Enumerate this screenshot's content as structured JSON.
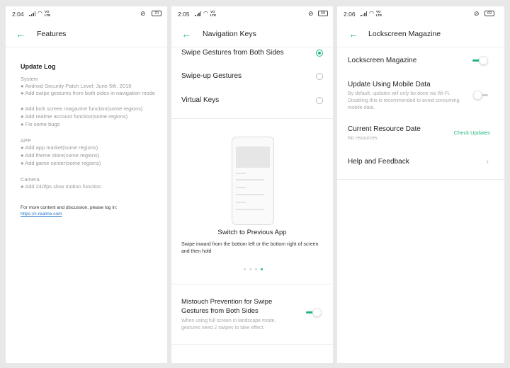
{
  "accent_color": "#1fb87a",
  "panels": [
    {
      "status": {
        "time": "2:04",
        "battery": "70"
      },
      "title": "Features",
      "update_log": {
        "heading": "Update Log",
        "system": {
          "label": "System",
          "items": [
            "● Android Security Patch Level: June 5th, 2019",
            "● Add swipe gestures from both sides in navigation mode",
            "● Add lock screen magazine function(some regions)",
            "● Add realme account function(some regions)",
            "● Fix some bugs"
          ]
        },
        "app": {
          "label": "APP",
          "items": [
            "● Add app market(some regions)",
            "● Add theme store(some regions)",
            "● Add game center(some regions)"
          ]
        },
        "camera": {
          "label": "Camera",
          "items": [
            "● Add 240fps slow motion function"
          ]
        },
        "footer": "For more content and discussion, please log in:",
        "link": "https://c.realme.com"
      }
    },
    {
      "status": {
        "time": "2:05",
        "battery": "69"
      },
      "title": "Navigation Keys",
      "options": [
        {
          "label": "Swipe Gestures from Both Sides",
          "selected": true
        },
        {
          "label": "Swipe-up Gestures",
          "selected": false
        },
        {
          "label": "Virtual Keys",
          "selected": false
        }
      ],
      "demo": {
        "title": "Switch to Previous App",
        "description": "Swipe inward from the bottom left or the bottom right of screen and then hold",
        "page_count": 4,
        "active_page": 3
      },
      "mistouch": {
        "title": "Mistouch Prevention for Swipe Gestures from Both Sides",
        "description": "When using full screen in landscape mode, gestures need 2 swipes to take effect.",
        "enabled": true
      }
    },
    {
      "status": {
        "time": "2:06",
        "battery": "69"
      },
      "title": "Lockscreen Magazine",
      "magazine": {
        "label": "Lockscreen Magazine",
        "enabled": true
      },
      "mobile_data": {
        "label": "Update Using Mobile Data",
        "description": "By default, updates will only be done via Wi-Fi. Disabling this is recommended to avoid consuming mobile data.",
        "enabled": false
      },
      "resource": {
        "label": "Current Resource Date",
        "value": "No resources",
        "action": "Check Updates"
      },
      "help": {
        "label": "Help and Feedback"
      }
    }
  ]
}
